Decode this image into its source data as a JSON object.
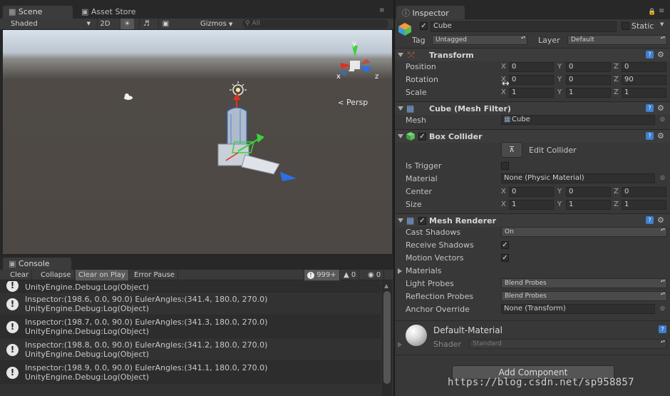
{
  "scene": {
    "tabs": [
      {
        "label": "Scene",
        "icon": "grid-icon"
      },
      {
        "label": "Asset Store",
        "icon": "bag-icon"
      }
    ],
    "toolbar": {
      "shading": "Shaded",
      "mode_2d": "2D",
      "gizmos": "Gizmos",
      "search_placeholder": "All"
    },
    "persp_label": "Persp",
    "gizmo_axes": {
      "x": "x",
      "y": "y",
      "z": "z"
    }
  },
  "console": {
    "tab": "Console",
    "toolbar": {
      "clear": "Clear",
      "collapse": "Collapse",
      "clear_on_play": "Clear on Play",
      "error_pause": "Error Pause"
    },
    "counts": {
      "logs": "999+",
      "warnings": "0",
      "errors": "0"
    },
    "partial_top": "UnityEngine.Debug:Log(Object)",
    "entries": [
      {
        "line1": "Inspector:(198.6, 0.0, 90.0) EulerAngles:(341.4, 180.0, 270.0)",
        "line2": "UnityEngine.Debug:Log(Object)"
      },
      {
        "line1": "Inspector:(198.7, 0.0, 90.0) EulerAngles:(341.3, 180.0, 270.0)",
        "line2": "UnityEngine.Debug:Log(Object)"
      },
      {
        "line1": "Inspector:(198.8, 0.0, 90.0) EulerAngles:(341.2, 180.0, 270.0)",
        "line2": "UnityEngine.Debug:Log(Object)"
      },
      {
        "line1": "Inspector:(198.9, 0.0, 90.0) EulerAngles:(341.1, 180.0, 270.0)",
        "line2": "UnityEngine.Debug:Log(Object)"
      }
    ]
  },
  "inspector": {
    "tab": "Inspector",
    "object": {
      "name": "Cube",
      "static_label": "Static",
      "tag_label": "Tag",
      "tag": "Untagged",
      "layer_label": "Layer",
      "layer": "Default"
    },
    "transform": {
      "title": "Transform",
      "position_label": "Position",
      "position": {
        "x": "0",
        "y": "0",
        "z": "0"
      },
      "rotation_label": "Rotation",
      "rotation": {
        "x": "0",
        "y": "0",
        "z": "90"
      },
      "scale_label": "Scale",
      "scale": {
        "x": "1",
        "y": "1",
        "z": "1"
      }
    },
    "mesh_filter": {
      "title": "Cube (Mesh Filter)",
      "mesh_label": "Mesh",
      "mesh": "Cube"
    },
    "box_collider": {
      "title": "Box Collider",
      "edit_label": "Edit Collider",
      "is_trigger_label": "Is Trigger",
      "material_label": "Material",
      "material": "None (Physic Material)",
      "center_label": "Center",
      "center": {
        "x": "0",
        "y": "0",
        "z": "0"
      },
      "size_label": "Size",
      "size": {
        "x": "1",
        "y": "1",
        "z": "1"
      }
    },
    "mesh_renderer": {
      "title": "Mesh Renderer",
      "cast_shadows_label": "Cast Shadows",
      "cast_shadows": "On",
      "receive_shadows_label": "Receive Shadows",
      "motion_vectors_label": "Motion Vectors",
      "materials_label": "Materials",
      "light_probes_label": "Light Probes",
      "light_probes": "Blend Probes",
      "reflection_probes_label": "Reflection Probes",
      "reflection_probes": "Blend Probes",
      "anchor_override_label": "Anchor Override",
      "anchor_override": "None (Transform)"
    },
    "material": {
      "name": "Default-Material",
      "shader_label": "Shader",
      "shader": "Standard"
    },
    "add_component": "Add Component"
  },
  "watermark": "https://blog.csdn.net/sp958857"
}
